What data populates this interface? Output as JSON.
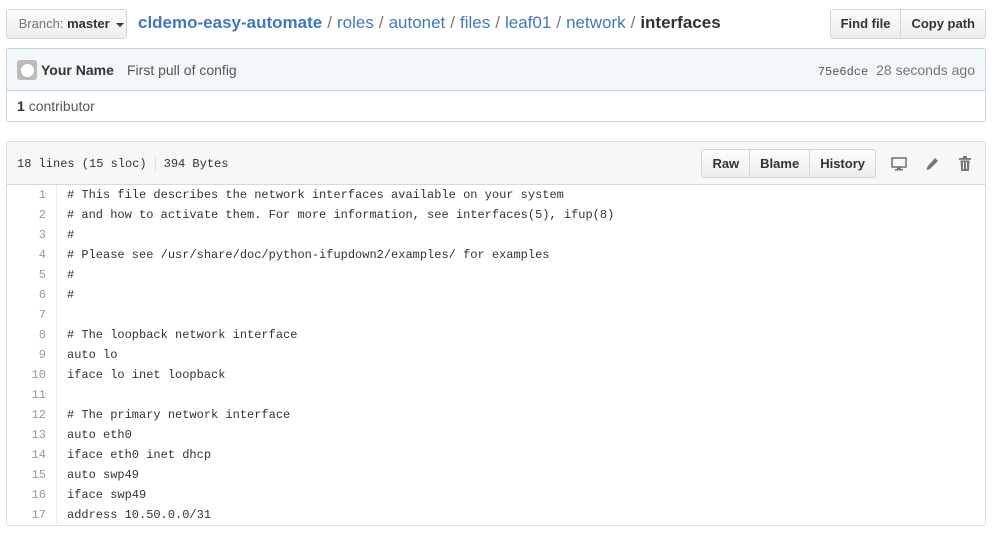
{
  "topbar": {
    "branch_prefix": "Branch:",
    "branch_name": "master",
    "breadcrumb": [
      {
        "label": "cldemo-easy-automate",
        "type": "repo"
      },
      {
        "label": "roles",
        "type": "link"
      },
      {
        "label": "autonet",
        "type": "link"
      },
      {
        "label": "files",
        "type": "link"
      },
      {
        "label": "leaf01",
        "type": "link"
      },
      {
        "label": "network",
        "type": "link"
      }
    ],
    "breadcrumb_separator": "/",
    "current_file": "interfaces",
    "find_file_label": "Find file",
    "copy_path_label": "Copy path"
  },
  "commit": {
    "author": "Your Name",
    "message": "First pull of config",
    "sha": "75e6dce",
    "time": "28 seconds ago",
    "contributors_count": "1",
    "contributors_label": "contributor"
  },
  "file": {
    "lines_info": "18 lines (15 sloc)",
    "size": "394 Bytes",
    "raw_label": "Raw",
    "blame_label": "Blame",
    "history_label": "History",
    "icons": [
      "desktop-icon",
      "pencil-icon",
      "trash-icon"
    ],
    "lines": [
      {
        "n": "1",
        "t": "# This file describes the network interfaces available on your system"
      },
      {
        "n": "2",
        "t": "# and how to activate them. For more information, see interfaces(5), ifup(8)"
      },
      {
        "n": "3",
        "t": "#"
      },
      {
        "n": "4",
        "t": "# Please see /usr/share/doc/python-ifupdown2/examples/ for examples"
      },
      {
        "n": "5",
        "t": "#"
      },
      {
        "n": "6",
        "t": "#"
      },
      {
        "n": "7",
        "t": ""
      },
      {
        "n": "8",
        "t": "# The loopback network interface"
      },
      {
        "n": "9",
        "t": "auto lo"
      },
      {
        "n": "10",
        "t": "iface lo inet loopback"
      },
      {
        "n": "11",
        "t": ""
      },
      {
        "n": "12",
        "t": "# The primary network interface"
      },
      {
        "n": "13",
        "t": "auto eth0"
      },
      {
        "n": "14",
        "t": "iface eth0 inet dhcp"
      },
      {
        "n": "15",
        "t": "auto swp49"
      },
      {
        "n": "16",
        "t": "iface swp49"
      },
      {
        "n": "17",
        "t": "address 10.50.0.0/31"
      }
    ]
  },
  "colors": {
    "link": "#4078c0",
    "commit_bg": "#f2f8fa",
    "commit_border": "#c5d5dd"
  }
}
